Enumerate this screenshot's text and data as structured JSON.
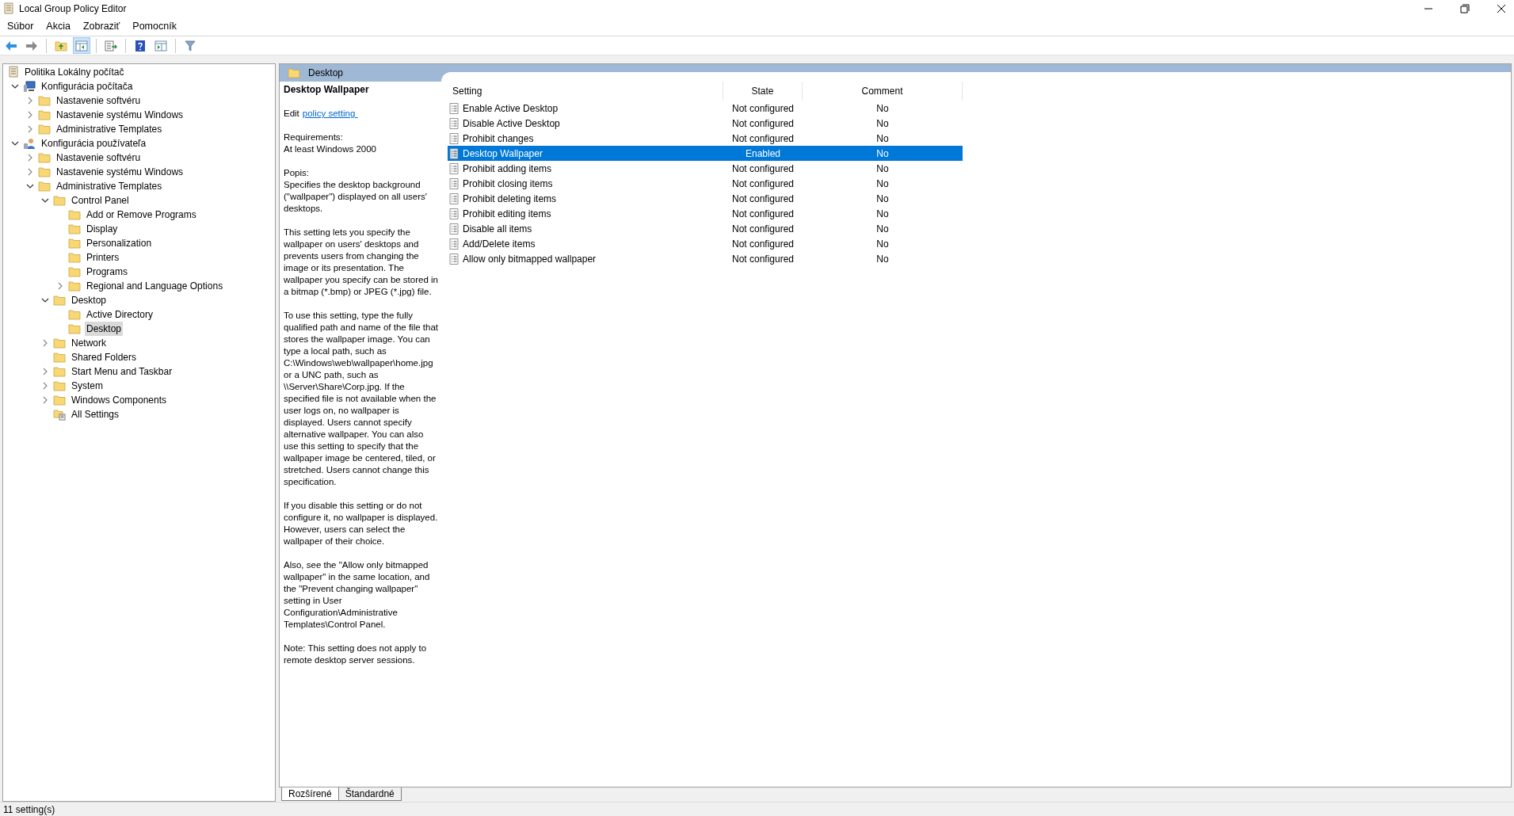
{
  "window": {
    "title": "Local Group Policy Editor"
  },
  "menu": [
    "Súbor",
    "Akcia",
    "Zobraziť",
    "Pomocník"
  ],
  "toolbar": [
    {
      "kind": "back",
      "pressed": false
    },
    {
      "kind": "forward",
      "pressed": false
    },
    {
      "kind": "sep"
    },
    {
      "kind": "up",
      "pressed": false
    },
    {
      "kind": "tree",
      "pressed": true
    },
    {
      "kind": "sep"
    },
    {
      "kind": "export",
      "pressed": false
    },
    {
      "kind": "sep"
    },
    {
      "kind": "help",
      "pressed": false
    },
    {
      "kind": "properties",
      "pressed": false
    },
    {
      "kind": "sep"
    },
    {
      "kind": "filter",
      "pressed": false
    }
  ],
  "tree": [
    {
      "label": "Politika Lokálny počítač",
      "kind": "policy",
      "selected": false,
      "children": [
        {
          "label": "Konfigurácia počítača",
          "kind": "computer",
          "expanded": true,
          "selected": false,
          "children": [
            {
              "label": "Nastavenie softvéru",
              "kind": "folder",
              "expanded": false,
              "selected": false
            },
            {
              "label": "Nastavenie systému Windows",
              "kind": "folder",
              "expanded": false,
              "selected": false
            },
            {
              "label": "Administrative Templates",
              "kind": "folder",
              "expanded": false,
              "selected": false
            }
          ]
        },
        {
          "label": "Konfigurácia používateľa",
          "kind": "user",
          "expanded": true,
          "selected": false,
          "children": [
            {
              "label": "Nastavenie softvéru",
              "kind": "folder",
              "expanded": false,
              "selected": false
            },
            {
              "label": "Nastavenie systému Windows",
              "kind": "folder",
              "expanded": false,
              "selected": false
            },
            {
              "label": "Administrative Templates",
              "kind": "folder",
              "expanded": true,
              "selected": false,
              "children": [
                {
                  "label": "Control Panel",
                  "kind": "folder",
                  "expanded": true,
                  "selected": false,
                  "children": [
                    {
                      "label": "Add or Remove Programs",
                      "kind": "folder",
                      "selected": false
                    },
                    {
                      "label": "Display",
                      "kind": "folder",
                      "selected": false
                    },
                    {
                      "label": "Personalization",
                      "kind": "folder",
                      "selected": false
                    },
                    {
                      "label": "Printers",
                      "kind": "folder",
                      "selected": false
                    },
                    {
                      "label": "Programs",
                      "kind": "folder",
                      "selected": false
                    },
                    {
                      "label": "Regional and Language Options",
                      "kind": "folder",
                      "expanded": false,
                      "selected": false
                    }
                  ]
                },
                {
                  "label": "Desktop",
                  "kind": "folder",
                  "expanded": true,
                  "selected": false,
                  "children": [
                    {
                      "label": "Active Directory",
                      "kind": "folder",
                      "selected": false
                    },
                    {
                      "label": "Desktop",
                      "kind": "folder",
                      "selected": true
                    }
                  ]
                },
                {
                  "label": "Network",
                  "kind": "folder",
                  "expanded": false,
                  "selected": false
                },
                {
                  "label": "Shared Folders",
                  "kind": "folder",
                  "selected": false
                },
                {
                  "label": "Start Menu and Taskbar",
                  "kind": "folder",
                  "expanded": false,
                  "selected": false
                },
                {
                  "label": "System",
                  "kind": "folder",
                  "expanded": false,
                  "selected": false
                },
                {
                  "label": "Windows Components",
                  "kind": "folder",
                  "expanded": false,
                  "selected": false
                },
                {
                  "label": "All Settings",
                  "kind": "settings",
                  "selected": false
                }
              ]
            }
          ]
        }
      ]
    }
  ],
  "pane_header": "Desktop",
  "description": {
    "title": "Desktop Wallpaper",
    "edit_prefix": "Edit",
    "edit_link": "policy setting ",
    "requirements_label": "Requirements:",
    "requirements": "At least Windows 2000",
    "description_label": "Popis:",
    "paragraphs": [
      "Specifies the desktop background (\"wallpaper\") displayed on all users' desktops.",
      "This setting lets you specify the wallpaper on users' desktops and prevents users from changing the image or its presentation. The wallpaper you specify can be stored in a bitmap (*.bmp) or JPEG (*.jpg) file.",
      "To use this setting, type the fully qualified path and name of the file that stores the wallpaper image. You can type a local path, such as C:\\Windows\\web\\wallpaper\\home.jpg or a UNC path, such as \\\\Server\\Share\\Corp.jpg. If the specified file is not available when the user logs on, no wallpaper is displayed. Users cannot specify alternative wallpaper. You can also use this setting to specify that the wallpaper image be centered, tiled, or stretched. Users cannot change this specification.",
      "If you disable this setting or do not configure it, no wallpaper is displayed. However, users can select the wallpaper of their choice.",
      "Also, see the \"Allow only bitmapped wallpaper\" in the same location, and the \"Prevent changing wallpaper\" setting in User Configuration\\Administrative Templates\\Control Panel.",
      "Note: This setting does not apply to remote desktop server sessions."
    ]
  },
  "table": {
    "columns": [
      "Setting",
      "State",
      "Comment"
    ],
    "rows": [
      {
        "setting": "Enable Active Desktop",
        "state": "Not configured",
        "comment": "No",
        "selected": false
      },
      {
        "setting": "Disable Active Desktop",
        "state": "Not configured",
        "comment": "No",
        "selected": false
      },
      {
        "setting": "Prohibit changes",
        "state": "Not configured",
        "comment": "No",
        "selected": false
      },
      {
        "setting": "Desktop Wallpaper",
        "state": "Enabled",
        "comment": "No",
        "selected": true
      },
      {
        "setting": "Prohibit adding items",
        "state": "Not configured",
        "comment": "No",
        "selected": false
      },
      {
        "setting": "Prohibit closing items",
        "state": "Not configured",
        "comment": "No",
        "selected": false
      },
      {
        "setting": "Prohibit deleting items",
        "state": "Not configured",
        "comment": "No",
        "selected": false
      },
      {
        "setting": "Prohibit editing items",
        "state": "Not configured",
        "comment": "No",
        "selected": false
      },
      {
        "setting": "Disable all items",
        "state": "Not configured",
        "comment": "No",
        "selected": false
      },
      {
        "setting": "Add/Delete items",
        "state": "Not configured",
        "comment": "No",
        "selected": false
      },
      {
        "setting": "Allow only bitmapped wallpaper",
        "state": "Not configured",
        "comment": "No",
        "selected": false
      }
    ]
  },
  "tabs": [
    {
      "label": "Rozšírené",
      "selected": true
    },
    {
      "label": "Štandardné",
      "selected": false
    }
  ],
  "status_bar": "11 setting(s)"
}
